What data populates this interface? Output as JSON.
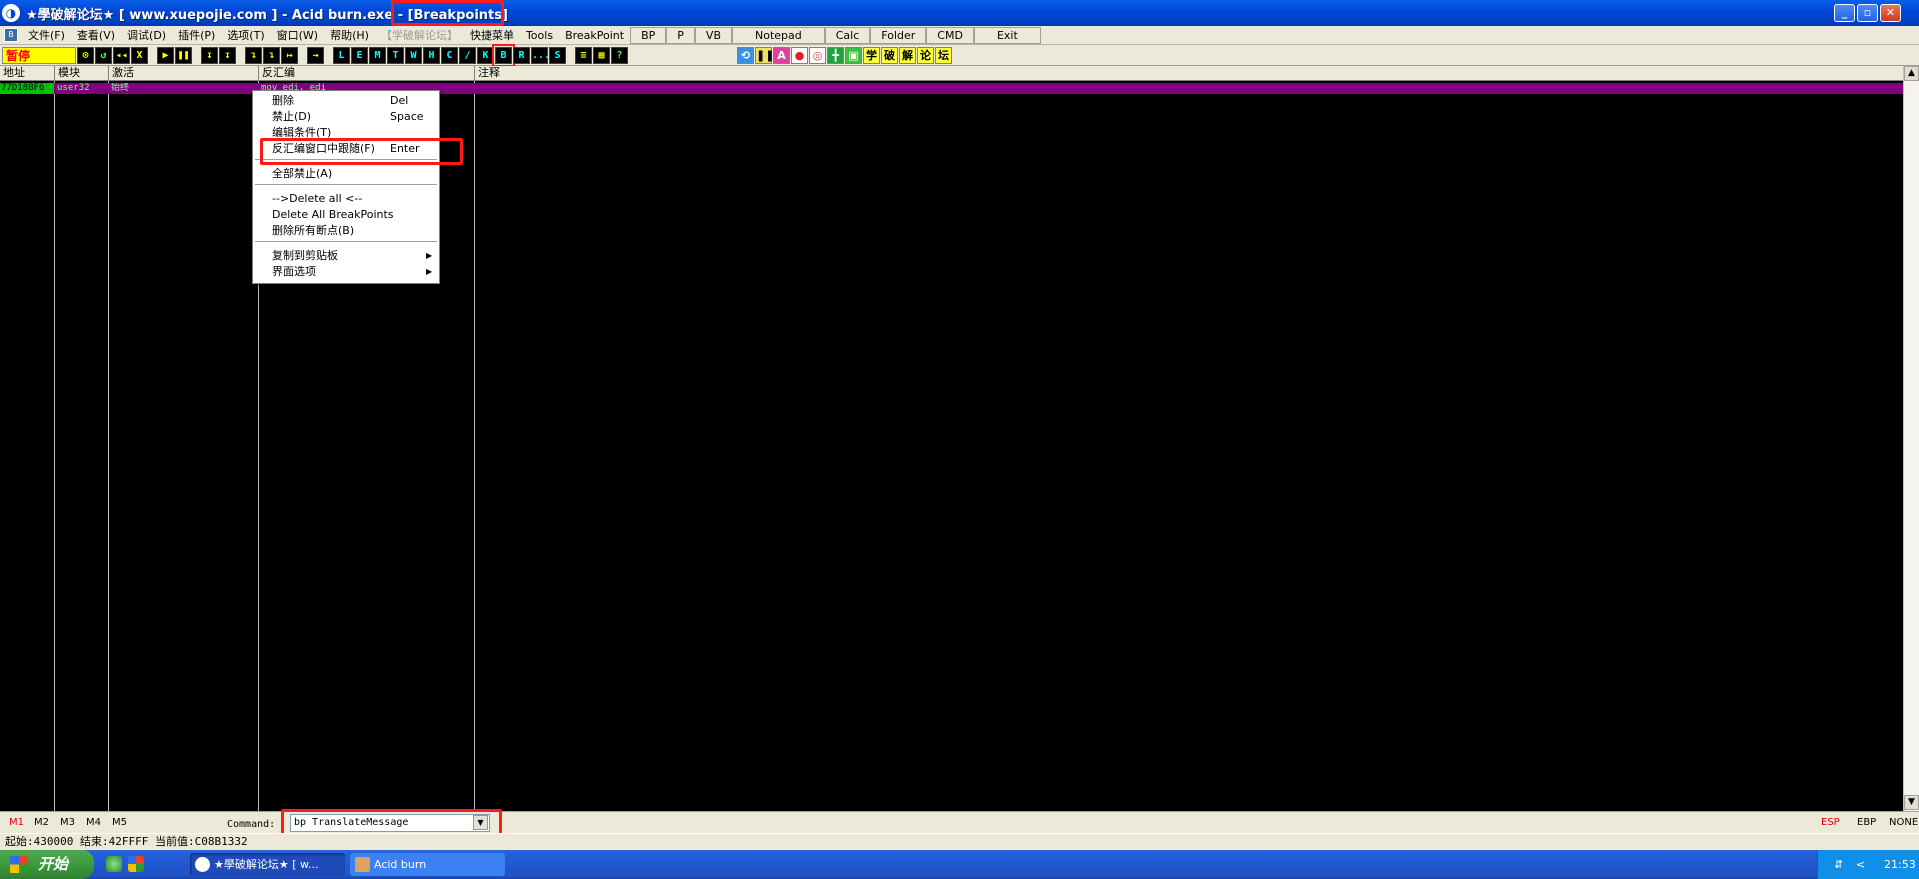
{
  "window": {
    "title": "★學破解论坛★ [ www.xuepojie.com ]  - Acid burn.exe - [Breakpoints]",
    "icon": "debugger-app-icon",
    "controls": {
      "minimize": "_",
      "maximize": "▫",
      "close": "✕"
    }
  },
  "menubar": {
    "items": [
      "文件(F)",
      "查看(V)",
      "调试(D)",
      "插件(P)",
      "选项(T)",
      "窗口(W)",
      "帮助(H)",
      "【学破解论坛】",
      "快捷菜单",
      "Tools",
      "BreakPoint"
    ],
    "buttons": [
      "BP",
      "P",
      "VB",
      "Notepad",
      "Calc",
      "Folder",
      "CMD",
      "Exit"
    ],
    "mdi_controls": {
      "minimize": "_",
      "restore": "❐",
      "close": "✕"
    }
  },
  "toolbar": {
    "status": "暂停",
    "group1": [
      "⊙",
      "↺",
      "◂◂",
      "X"
    ],
    "group2": [
      "▶",
      "❚❚"
    ],
    "group3": [
      "↧",
      "↧",
      "↴",
      "↴",
      "↦"
    ],
    "group4": [
      "→"
    ],
    "letters": [
      "L",
      "E",
      "M",
      "T",
      "W",
      "H",
      "C",
      "/",
      "K",
      "B",
      "R",
      "...",
      "S"
    ],
    "highlighted_letter": "B",
    "group5": [
      "≡",
      "▦",
      "?"
    ],
    "right_icons": [
      "⟲",
      "❚❚",
      "A",
      "●",
      "◎",
      "╋",
      "▣"
    ],
    "right_text_icons": [
      "学",
      "破",
      "解",
      "论",
      "坛"
    ]
  },
  "columns": [
    "地址",
    "模块",
    "激活",
    "反汇编",
    "注释"
  ],
  "breakpoints": [
    {
      "address": "77D18BF6",
      "module": "user32",
      "active": "始终",
      "disasm": "mov edi, edi",
      "comment": ""
    }
  ],
  "context_menu": {
    "items": [
      {
        "label": "删除",
        "shortcut": "Del"
      },
      {
        "label": "禁止(D)",
        "shortcut": "Space"
      },
      {
        "label": "编辑条件(T)",
        "shortcut": ""
      },
      {
        "label": "反汇编窗口中跟随(F)",
        "shortcut": "Enter"
      },
      {
        "label": "全部禁止(A)",
        "shortcut": ""
      },
      {
        "label": "-->Delete all <--",
        "shortcut": ""
      },
      {
        "label": "Delete All BreakPoints",
        "shortcut": ""
      },
      {
        "label": "删除所有断点(B)",
        "shortcut": ""
      },
      {
        "label": "复制到剪贴板",
        "shortcut": ""
      },
      {
        "label": "界面选项",
        "shortcut": ""
      }
    ]
  },
  "command_bar": {
    "markers": [
      "M1",
      "M2",
      "M3",
      "M4",
      "M5"
    ],
    "label": "Command:",
    "value": "bp TranslateMessage",
    "registers": [
      "ESP",
      "EBP",
      "NONE"
    ]
  },
  "status": {
    "text": "起始:430000 结束:42FFFF 当前值:C08B1332"
  },
  "taskbar": {
    "start_label": "开始",
    "tasks": [
      "★學破解论坛★ [ w...",
      "Acid burn"
    ],
    "tray_arrow": "<",
    "clock": "21:53"
  },
  "colors": {
    "highlight_red": "#ff1a1a",
    "selected_row": "#800080",
    "address_cell": "#00c000",
    "status_yellow": "#ffff00"
  }
}
